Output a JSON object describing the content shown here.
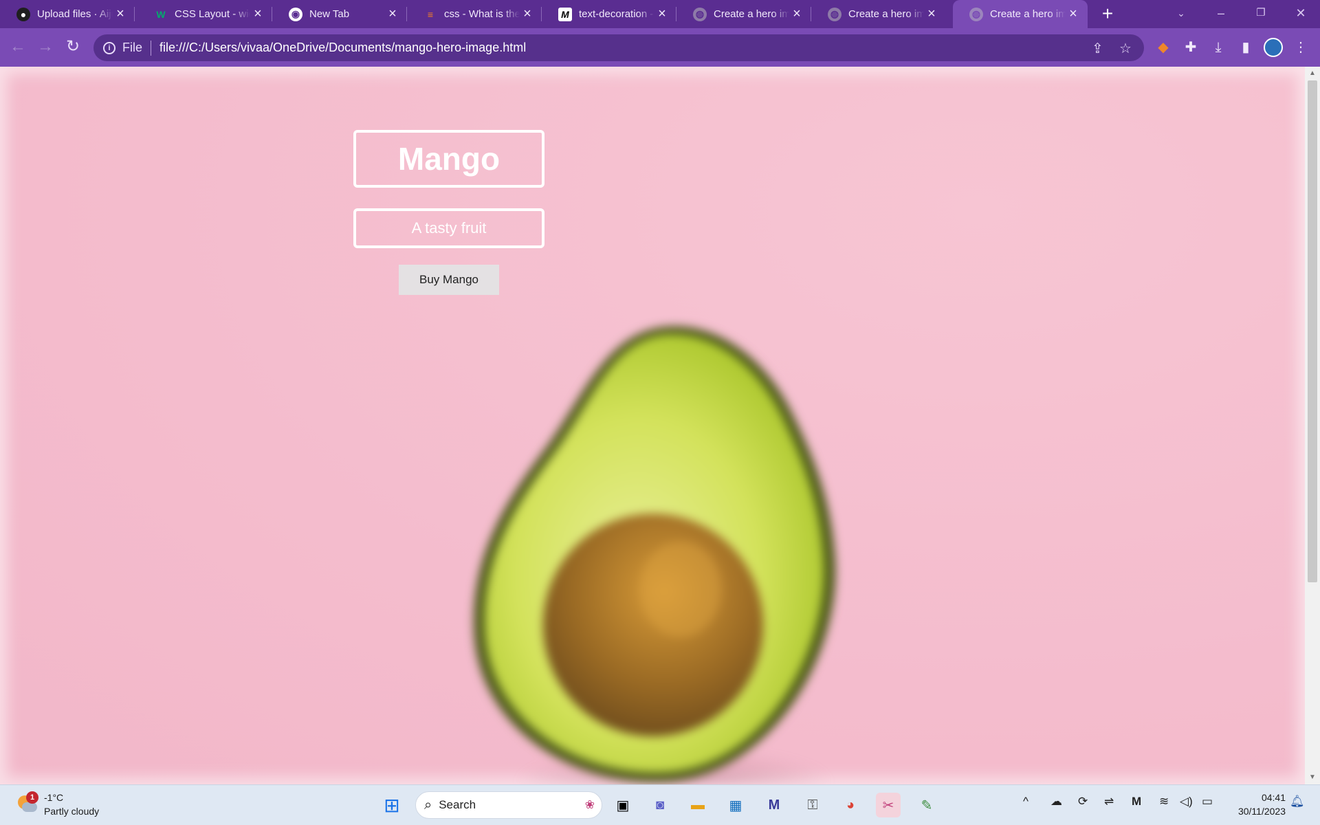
{
  "browser": {
    "tabs": [
      {
        "title": "Upload files · Aiju",
        "icon": "github-icon"
      },
      {
        "title": "CSS Layout - wid",
        "icon": "w3schools-icon"
      },
      {
        "title": "New Tab",
        "icon": "chrome-icon"
      },
      {
        "title": "css - What is the",
        "icon": "stackoverflow-icon"
      },
      {
        "title": "text-decoration -",
        "icon": "mdn-icon"
      },
      {
        "title": "Create a hero im",
        "icon": "globe-icon"
      },
      {
        "title": "Create a hero im",
        "icon": "globe-icon"
      },
      {
        "title": "Create a hero im",
        "icon": "globe-icon",
        "active": true
      }
    ],
    "address_bar": {
      "scheme_label": "File",
      "url": "file:///C:/Users/vivaa/OneDrive/Documents/mango-hero-image.html"
    },
    "colors": {
      "frame": "#5a2d91",
      "toolbar": "#7a4bb5",
      "omnibox": "#56308c"
    }
  },
  "page": {
    "title": "Mango",
    "subtitle": "A tasty fruit",
    "button_label": "Buy Mango",
    "background_color": "#f6bfd0",
    "image_subject": "avocado-half"
  },
  "taskbar": {
    "weather": {
      "temperature": "-1°C",
      "condition": "Partly cloudy",
      "badge": "1"
    },
    "search_placeholder": "Search",
    "clock": {
      "time": "04:41",
      "date": "30/11/2023"
    }
  }
}
